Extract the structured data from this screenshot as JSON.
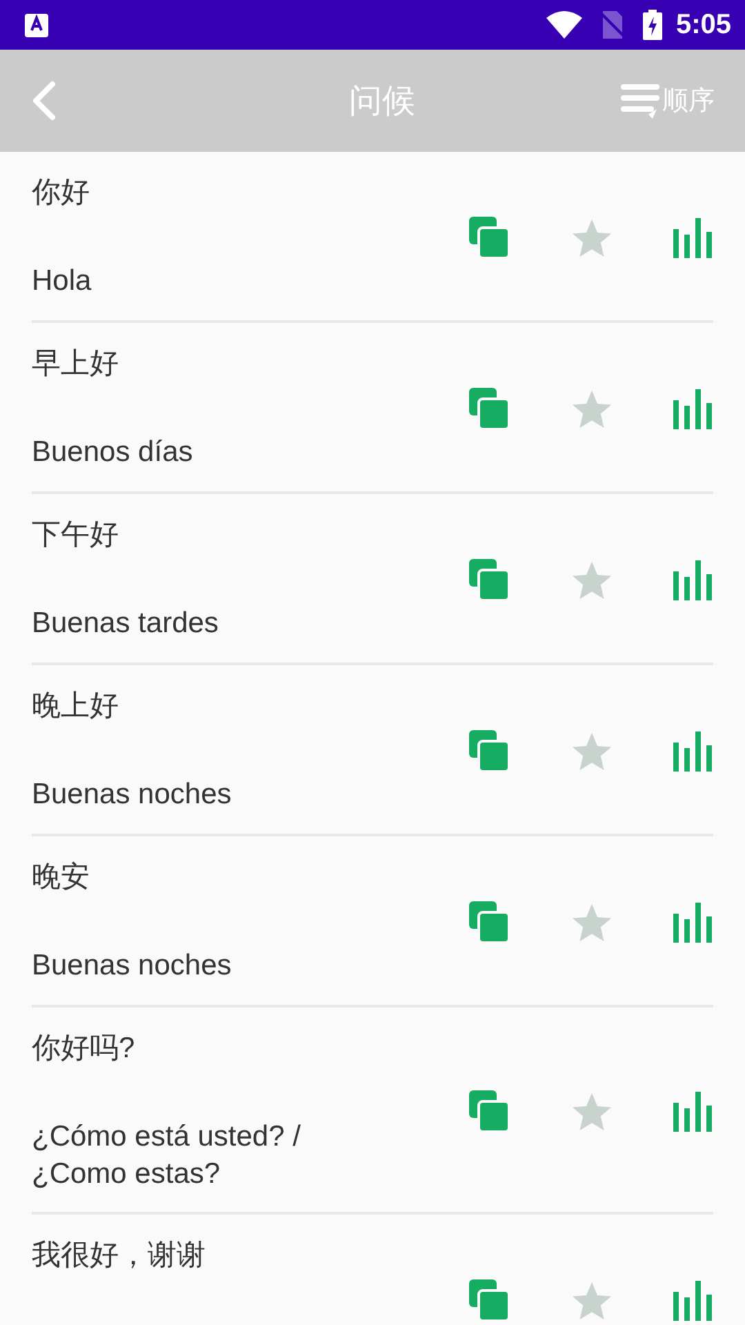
{
  "status_bar": {
    "time": "5:05"
  },
  "toolbar": {
    "title": "问候",
    "sort_label": "顺序"
  },
  "phrases": [
    {
      "chinese": "你好",
      "spanish": "Hola",
      "favorite": false
    },
    {
      "chinese": "早上好",
      "spanish": "Buenos días",
      "favorite": false
    },
    {
      "chinese": "下午好",
      "spanish": "Buenas tardes",
      "favorite": false
    },
    {
      "chinese": "晚上好",
      "spanish": "Buenas noches",
      "favorite": false
    },
    {
      "chinese": "晚安",
      "spanish": "Buenas noches",
      "favorite": false
    },
    {
      "chinese": "你好吗?",
      "spanish": "¿Cómo está usted? / ¿Como estas?",
      "favorite": false
    },
    {
      "chinese": "我很好，谢谢",
      "favorite": false
    }
  ]
}
